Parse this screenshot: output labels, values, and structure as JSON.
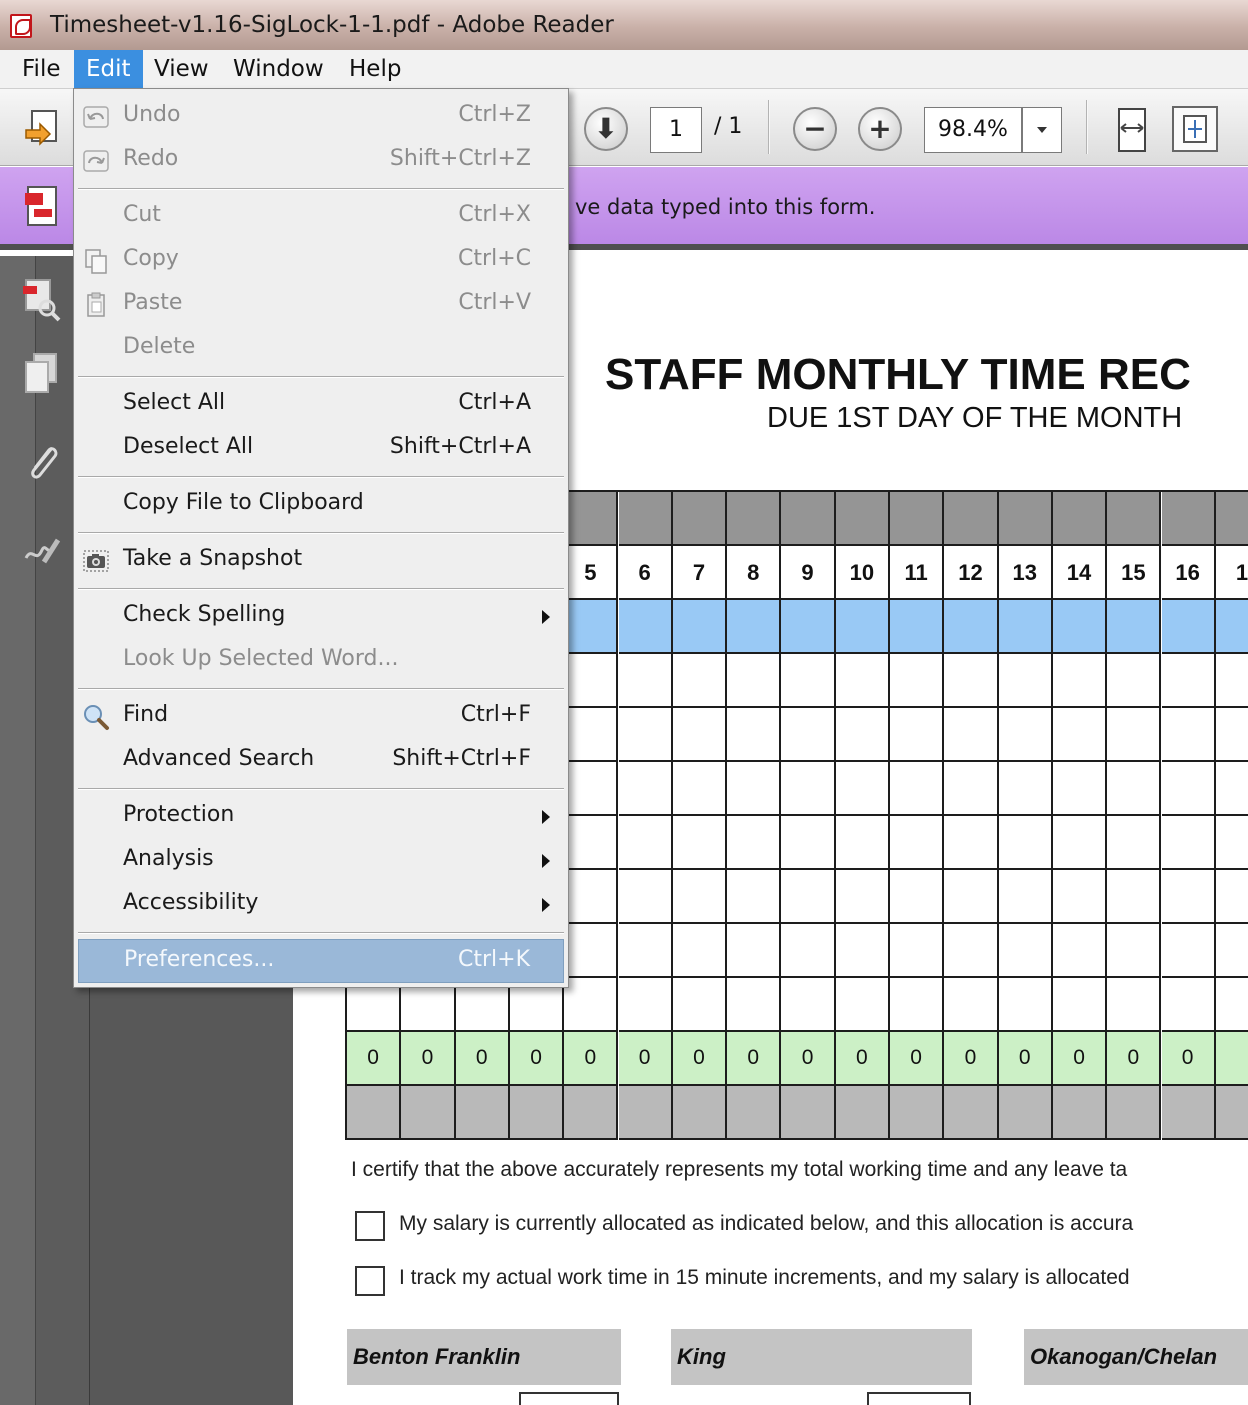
{
  "window": {
    "title": "Timesheet-v1.16-SigLock-1-1.pdf - Adobe Reader"
  },
  "menubar": {
    "items": [
      "File",
      "Edit",
      "View",
      "Window",
      "Help"
    ],
    "active": "Edit"
  },
  "toolbar": {
    "page_current": "1",
    "page_total": "/ 1",
    "zoom": "98.4%"
  },
  "notice": {
    "text": "ve data typed into this form."
  },
  "edit_menu": {
    "items": [
      {
        "label": "Undo",
        "shortcut": "Ctrl+Z",
        "disabled": true,
        "icon": "undo-icon"
      },
      {
        "label": "Redo",
        "shortcut": "Shift+Ctrl+Z",
        "disabled": true,
        "icon": "redo-icon"
      },
      {
        "label": "Cut",
        "shortcut": "Ctrl+X",
        "disabled": true
      },
      {
        "label": "Copy",
        "shortcut": "Ctrl+C",
        "disabled": true,
        "icon": "copy-icon"
      },
      {
        "label": "Paste",
        "shortcut": "Ctrl+V",
        "disabled": true,
        "icon": "paste-icon"
      },
      {
        "label": "Delete",
        "shortcut": "",
        "disabled": true
      },
      {
        "label": "Select All",
        "shortcut": "Ctrl+A"
      },
      {
        "label": "Deselect All",
        "shortcut": "Shift+Ctrl+A"
      },
      {
        "label": "Copy File to Clipboard",
        "shortcut": ""
      },
      {
        "label": "Take a Snapshot",
        "shortcut": "",
        "icon": "camera-icon"
      },
      {
        "label": "Check Spelling",
        "shortcut": "",
        "submenu": true
      },
      {
        "label": "Look Up Selected Word...",
        "shortcut": "",
        "disabled": true
      },
      {
        "label": "Find",
        "shortcut": "Ctrl+F",
        "icon": "magnifier-icon"
      },
      {
        "label": "Advanced Search",
        "shortcut": "Shift+Ctrl+F"
      },
      {
        "label": "Protection",
        "shortcut": "",
        "submenu": true
      },
      {
        "label": "Analysis",
        "shortcut": "",
        "submenu": true
      },
      {
        "label": "Accessibility",
        "shortcut": "",
        "submenu": true
      },
      {
        "label": "Preferences...",
        "shortcut": "Ctrl+K",
        "highlighted": true
      }
    ]
  },
  "document": {
    "title": "STAFF MONTHLY TIME REC",
    "subtitle": "DUE 1ST DAY OF THE MONTH",
    "day_headers": [
      "5",
      "6",
      "7",
      "8",
      "9",
      "10",
      "11",
      "12",
      "13",
      "14",
      "15",
      "16",
      "1"
    ],
    "totals": [
      "0",
      "0",
      "0",
      "0",
      "0",
      "0",
      "0",
      "0",
      "0",
      "0",
      "0",
      "0",
      "0",
      "0",
      "0",
      "0"
    ],
    "certify_text": "I certify that the above accurately represents my total working time and any leave ta",
    "checkbox_1": "My salary is currently allocated as indicated below, and this allocation is accura",
    "checkbox_2": "I track my actual work time in 15 minute increments, and my salary is allocated",
    "counties": [
      "Benton Franklin",
      "King",
      "Okanogan/Chelan"
    ]
  },
  "colors": {
    "menu_active": "#3b8fe0",
    "notice_bar": "#c497ec",
    "highlight": "#9ab8d8",
    "row_blue": "#99c9f5",
    "row_green": "#ccf0c6"
  }
}
